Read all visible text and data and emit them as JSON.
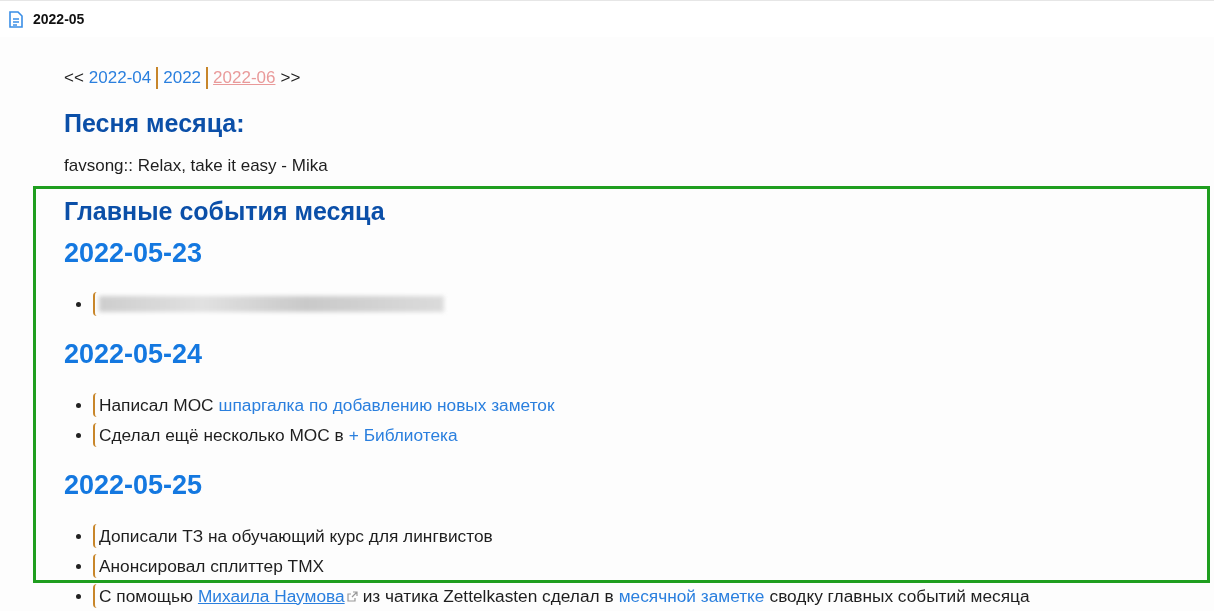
{
  "tab": {
    "title": "2022-05"
  },
  "nav": [
    {
      "kind": "text",
      "text": "<<"
    },
    {
      "kind": "link",
      "text": "2022-04"
    },
    {
      "kind": "separator"
    },
    {
      "kind": "link",
      "text": "2022"
    },
    {
      "kind": "separator"
    },
    {
      "kind": "unresolved_link",
      "text": "2022-06"
    },
    {
      "kind": "text",
      "text": ">>"
    }
  ],
  "song": {
    "heading": "Песня месяца:",
    "line": "favsong:: Relax, take it easy - Mika"
  },
  "highlights": {
    "heading": "Главные события месяца",
    "days": [
      {
        "date": "2022-05-23",
        "items": [
          {
            "segments": [
              {
                "kind": "redacted"
              }
            ]
          }
        ]
      },
      {
        "date": "2022-05-24",
        "items": [
          {
            "segments": [
              {
                "kind": "text",
                "text": "Написал МОС"
              },
              {
                "kind": "link",
                "text": "шпаргалка по добавлению новых заметок"
              }
            ]
          },
          {
            "segments": [
              {
                "kind": "text",
                "text": "Сделал ещё несколько МОС в"
              },
              {
                "kind": "link",
                "text": "+ Библиотека"
              }
            ]
          }
        ]
      },
      {
        "date": "2022-05-25",
        "items": [
          {
            "segments": [
              {
                "kind": "text",
                "text": "Дописали ТЗ на обучающий курс для лингвистов"
              }
            ]
          },
          {
            "segments": [
              {
                "kind": "text",
                "text": "Анонсировал сплиттер ТМХ"
              }
            ]
          },
          {
            "segments": [
              {
                "kind": "text",
                "text": "С помощью"
              },
              {
                "kind": "external_link",
                "text": "Михаила Наумова"
              },
              {
                "kind": "text",
                "text": "из чатика Zettelkasten сделал в"
              },
              {
                "kind": "link",
                "text": "месячной заметке"
              },
              {
                "kind": "text",
                "text": "сводку главных событий месяца"
              }
            ]
          }
        ]
      }
    ]
  }
}
